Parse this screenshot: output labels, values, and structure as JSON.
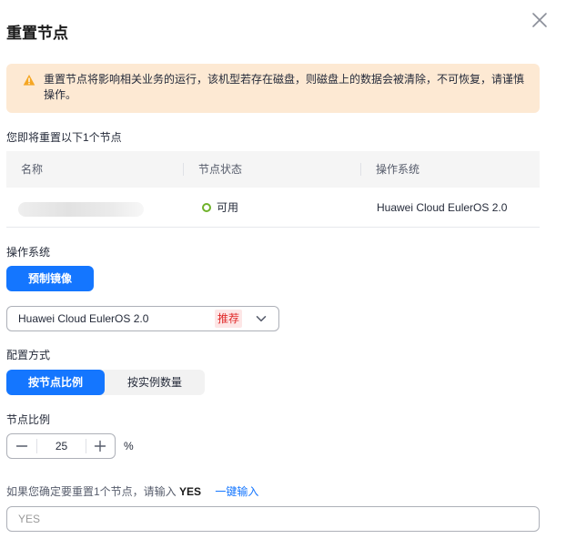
{
  "dialog": {
    "title": "重置节点",
    "close_icon": "close-icon"
  },
  "alert": {
    "icon": "warning-icon",
    "color": "#fde9d3",
    "text": "重置节点将影响相关业务的运行，该机型若存在磁盘，则磁盘上的数据会被清除，不可恢复，请谨慎操作。"
  },
  "summary": {
    "text": "您即将重置以下1个节点"
  },
  "table": {
    "headers": [
      "名称",
      "节点状态",
      "操作系统"
    ],
    "rows": [
      {
        "name": "",
        "status": "可用",
        "os": "Huawei Cloud EulerOS 2.0"
      }
    ]
  },
  "os_section": {
    "label": "操作系统",
    "image_button": "预制镜像",
    "select_value": "Huawei Cloud EulerOS 2.0",
    "select_tag": "推荐"
  },
  "config_section": {
    "label": "配置方式",
    "options": [
      "按节点比例",
      "按实例数量"
    ],
    "selected": "按节点比例"
  },
  "ratio_section": {
    "label": "节点比例",
    "value": "25",
    "unit": "%"
  },
  "confirm": {
    "prefix": "如果您确定要重置1个节点，请输入",
    "keyword": "YES",
    "link": "一键输入",
    "placeholder": "YES"
  },
  "colors": {
    "primary": "#1476ff",
    "status_ok": "#6fb22a",
    "warning": "#f5a623",
    "tag_red": "#e02a2a"
  }
}
